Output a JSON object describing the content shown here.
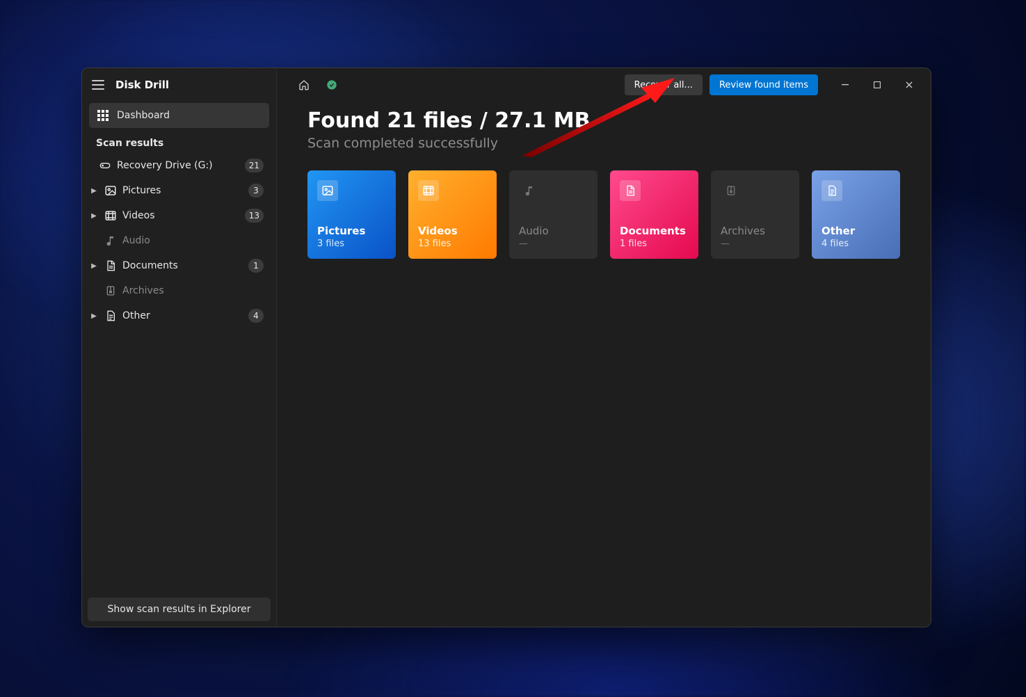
{
  "app_title": "Disk Drill",
  "sidebar": {
    "dashboard_label": "Dashboard",
    "section_label": "Scan results",
    "items": [
      {
        "label": "Recovery Drive (G:)",
        "count": "21",
        "icon": "drive",
        "expandable": false,
        "dim": false
      },
      {
        "label": "Pictures",
        "count": "3",
        "icon": "image",
        "expandable": true,
        "dim": false
      },
      {
        "label": "Videos",
        "count": "13",
        "icon": "video",
        "expandable": true,
        "dim": false
      },
      {
        "label": "Audio",
        "count": "",
        "icon": "audio",
        "expandable": false,
        "dim": true
      },
      {
        "label": "Documents",
        "count": "1",
        "icon": "document",
        "expandable": true,
        "dim": false
      },
      {
        "label": "Archives",
        "count": "",
        "icon": "archive",
        "expandable": false,
        "dim": true
      },
      {
        "label": "Other",
        "count": "4",
        "icon": "other",
        "expandable": true,
        "dim": false
      }
    ],
    "footer_label": "Show scan results in Explorer"
  },
  "toolbar": {
    "recover_label": "Recover all...",
    "review_label": "Review found items"
  },
  "main": {
    "headline": "Found 21 files / 27.1 MB",
    "subhead": "Scan completed successfully",
    "cards": [
      {
        "label": "Pictures",
        "count": "3 files",
        "class": "c-pictures",
        "icon": "image",
        "empty": false
      },
      {
        "label": "Videos",
        "count": "13 files",
        "class": "c-videos",
        "icon": "video",
        "empty": false
      },
      {
        "label": "Audio",
        "count": "—",
        "class": "",
        "icon": "audio",
        "empty": true
      },
      {
        "label": "Documents",
        "count": "1 files",
        "class": "c-documents",
        "icon": "document",
        "empty": false
      },
      {
        "label": "Archives",
        "count": "—",
        "class": "",
        "icon": "archive",
        "empty": true
      },
      {
        "label": "Other",
        "count": "4 files",
        "class": "c-other",
        "icon": "other",
        "empty": false
      }
    ]
  }
}
